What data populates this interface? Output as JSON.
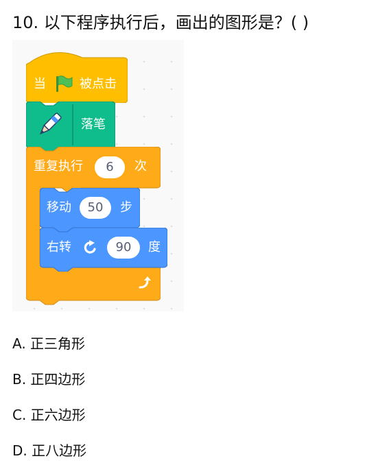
{
  "question": {
    "text": "10. 以下程序执行后，画出的图形是？(    )"
  },
  "blocks": {
    "when_flag": {
      "prefix": "当",
      "suffix": "被点击",
      "icon": "green-flag-icon"
    },
    "pen_down": {
      "label": "落笔",
      "icon": "pen-icon"
    },
    "repeat": {
      "label": "重复执行",
      "count": "6",
      "suffix": "次",
      "icon": "loop-arrow-icon"
    },
    "move": {
      "label": "移动",
      "steps": "50",
      "suffix": "步"
    },
    "turn": {
      "label": "右转",
      "degrees": "90",
      "suffix": "度",
      "icon": "rotate-clockwise-icon"
    }
  },
  "colors": {
    "events": "#FFBF00",
    "pen": "#0FBD8C",
    "control": "#FFAB19",
    "motion": "#4C97FF"
  },
  "options": [
    {
      "text": "A. 正三角形"
    },
    {
      "text": "B. 正四边形"
    },
    {
      "text": "C. 正六边形"
    },
    {
      "text": "D. 正八边形"
    }
  ]
}
